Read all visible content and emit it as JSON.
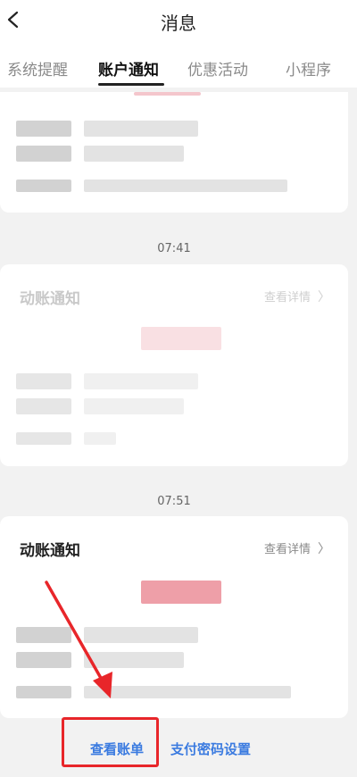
{
  "header": {
    "title": "消息",
    "back_icon": "chevron-left-icon"
  },
  "tabs": [
    {
      "label": "系统提醒",
      "active": false
    },
    {
      "label": "账户通知",
      "active": true
    },
    {
      "label": "优惠活动",
      "active": false
    },
    {
      "label": "小程序",
      "active": false
    }
  ],
  "messages": [
    {
      "time": "",
      "title": "",
      "detail_label": ""
    },
    {
      "time": "07:41",
      "title": "动账通知",
      "detail_label": "查看详情"
    },
    {
      "time": "07:51",
      "title": "动账通知",
      "detail_label": "查看详情"
    }
  ],
  "bottom_bar": {
    "view_bill_label": "查看账单",
    "payment_password_label": "支付密码设置"
  },
  "colors": {
    "accent": "#3b7be0",
    "annotation": "#e8262a"
  }
}
